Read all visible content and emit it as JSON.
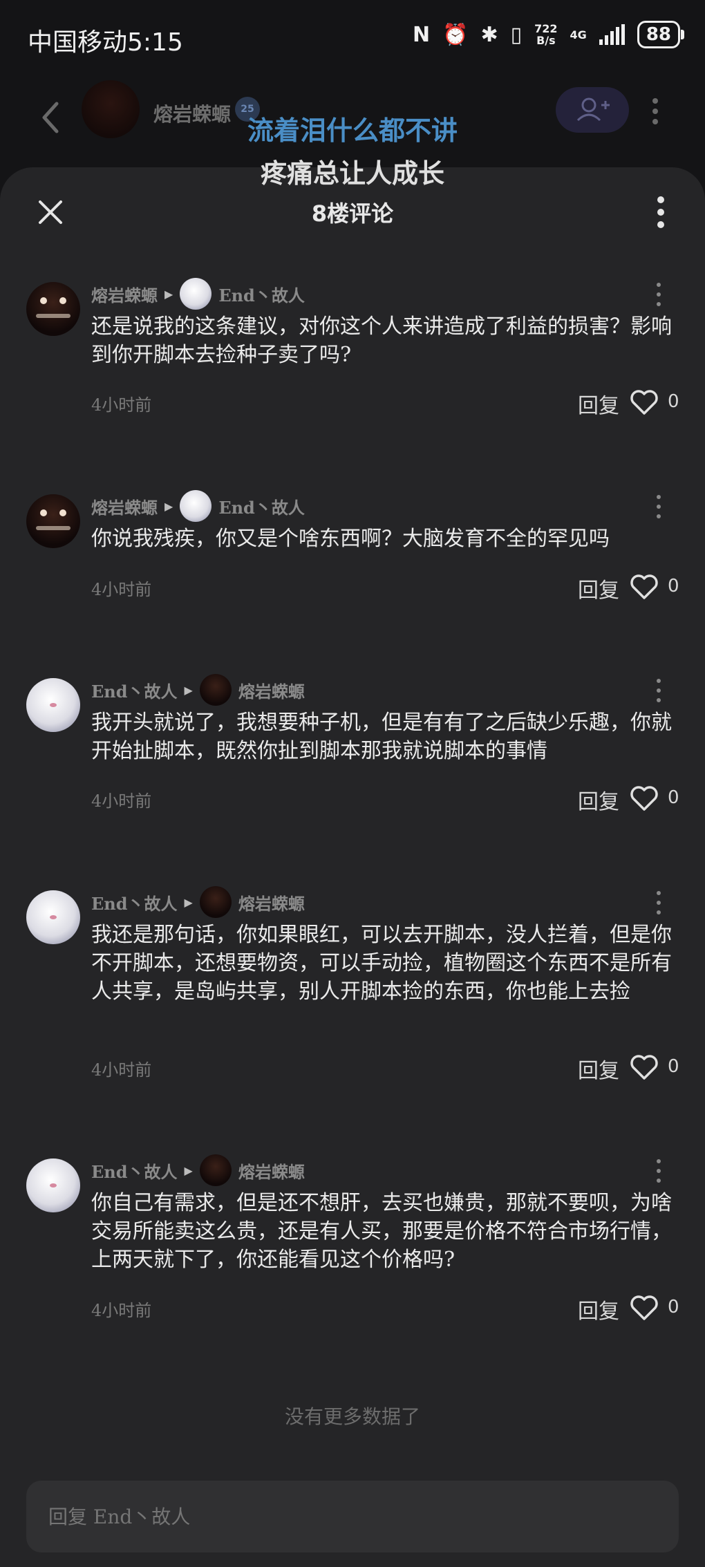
{
  "status_bar": {
    "carrier": "中国移动",
    "time": "5:15",
    "net_speed_value": "722",
    "net_speed_unit": "B/s",
    "network": "4G",
    "battery": "88"
  },
  "background_header": {
    "user_name": "熔岩蝾螈",
    "badge": "25",
    "overlay_line1": "流着泪什么都不讲",
    "overlay_line2": "疼痛总让人成长"
  },
  "sheet": {
    "title": "8楼评论"
  },
  "comments": [
    {
      "author": "熔岩蝾螈",
      "author_avatar": "lava-salamander",
      "reply_to": "End丶故人",
      "reply_to_avatar": "white-hair",
      "text": "还是说我的这条建议，对你这个人来讲造成了利益的损害？影响到你开脚本去捡种子卖了吗?",
      "time": "4小时前",
      "reply_label": "回复",
      "likes": "0"
    },
    {
      "author": "熔岩蝾螈",
      "author_avatar": "lava-salamander",
      "reply_to": "End丶故人",
      "reply_to_avatar": "white-hair",
      "text": "你说我残疾，你又是个啥东西啊？大脑发育不全的罕见吗",
      "time": "4小时前",
      "reply_label": "回复",
      "likes": "0"
    },
    {
      "author": "End丶故人",
      "author_avatar": "white-hair",
      "reply_to": "熔岩蝾螈",
      "reply_to_avatar": "lava-salamander",
      "text": "我开头就说了，我想要种子机，但是有有了之后缺少乐趣，你就开始扯脚本，既然你扯到脚本那我就说脚本的事情",
      "time": "4小时前",
      "reply_label": "回复",
      "likes": "0"
    },
    {
      "author": "End丶故人",
      "author_avatar": "white-hair",
      "reply_to": "熔岩蝾螈",
      "reply_to_avatar": "lava-salamander",
      "text": "我还是那句话，你如果眼红，可以去开脚本，没人拦着，但是你不开脚本，还想要物资，可以手动捡，植物圈这个东西不是所有人共享，是岛屿共享，别人开脚本捡的东西，你也能上去捡",
      "time": "4小时前",
      "reply_label": "回复",
      "likes": "0"
    },
    {
      "author": "End丶故人",
      "author_avatar": "white-hair",
      "reply_to": "熔岩蝾螈",
      "reply_to_avatar": "lava-salamander",
      "text": "你自己有需求，但是还不想肝，去买也嫌贵，那就不要呗，为啥交易所能卖这么贵，还是有人买，那要是价格不符合市场行情，上两天就下了，你还能看见这个价格吗?",
      "time": "4小时前",
      "reply_label": "回复",
      "likes": "0"
    }
  ],
  "no_more_text": "没有更多数据了",
  "reply_box": {
    "placeholder": "回复 End丶故人"
  }
}
